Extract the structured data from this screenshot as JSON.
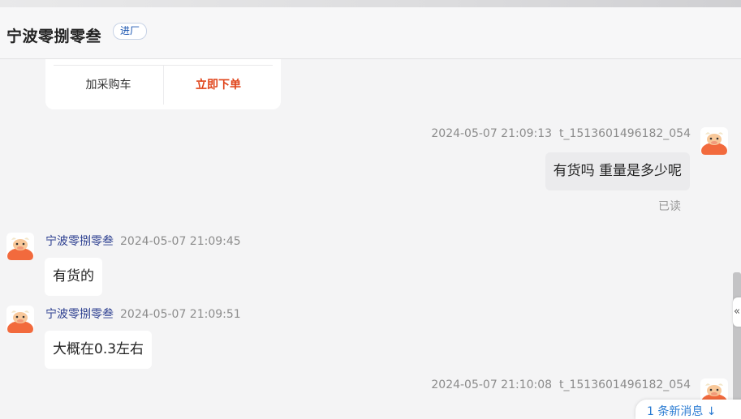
{
  "header": {
    "shop_name": "宁波零捌零叁",
    "badge": "进厂"
  },
  "order_card": {
    "add_to_cart": "加采购车",
    "buy_now": "立即下单"
  },
  "messages": [
    {
      "direction": "out",
      "time": "2024-05-07 21:09:13",
      "sender": "t_1513601496182_054",
      "text": "有货吗 重量是多少呢",
      "read_status": "已读"
    },
    {
      "direction": "in",
      "sender": "宁波零捌零叁",
      "time": "2024-05-07 21:09:45",
      "text": "有货的"
    },
    {
      "direction": "in",
      "sender": "宁波零捌零叁",
      "time": "2024-05-07 21:09:51",
      "text": "大概在0.3左右"
    },
    {
      "direction": "out",
      "time": "2024-05-07 21:10:08",
      "sender": "t_1513601496182_054"
    }
  ],
  "new_message_notice": "1 条新消息 ↓",
  "collapse_icon_glyph": "«",
  "colors": {
    "accent_blue": "#1a55b0",
    "buy_red": "#e0441a",
    "sender_name": "#2a3d8f",
    "avatar_orange": "#f26a3d"
  }
}
